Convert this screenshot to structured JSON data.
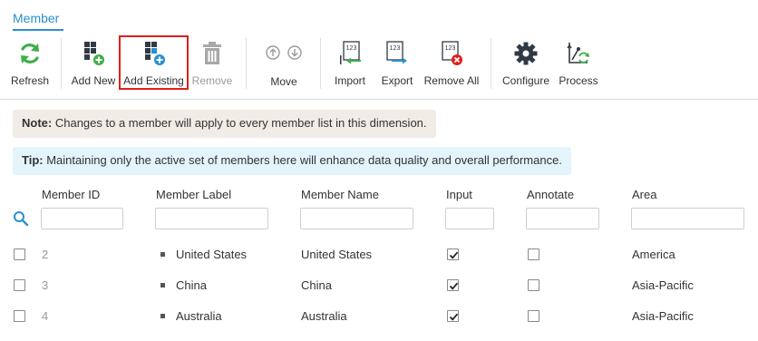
{
  "tabs": [
    {
      "label": "Member",
      "active": true
    }
  ],
  "toolbar": {
    "refresh": "Refresh",
    "add_new": "Add New",
    "add_existing": "Add Existing",
    "remove": "Remove",
    "move": "Move",
    "import": "Import",
    "export": "Export",
    "remove_all": "Remove All",
    "configure": "Configure",
    "process": "Process"
  },
  "icon_text": "123",
  "note": {
    "prefix": "Note:",
    "text": "Changes to a member will apply to every member list in this dimension."
  },
  "tip": {
    "prefix": "Tip:",
    "text": "Maintaining only the active set of members here will enhance data quality and overall performance."
  },
  "columns": [
    "Member ID",
    "Member Label",
    "Member Name",
    "Input",
    "Annotate",
    "Area"
  ],
  "rows": [
    {
      "id": "2",
      "label": "United States",
      "name": "United States",
      "input": true,
      "annotate": false,
      "area": "America"
    },
    {
      "id": "3",
      "label": "China",
      "name": "China",
      "input": true,
      "annotate": false,
      "area": "Asia-Pacific"
    },
    {
      "id": "4",
      "label": "Australia",
      "name": "Australia",
      "input": true,
      "annotate": false,
      "area": "Asia-Pacific"
    }
  ],
  "colors": {
    "accent": "#2a8fd0",
    "green": "#3fae49",
    "blue": "#2a8fd0",
    "red": "#e0201a",
    "note_bg": "#f1ece6",
    "tip_bg": "#e3f4fb"
  }
}
